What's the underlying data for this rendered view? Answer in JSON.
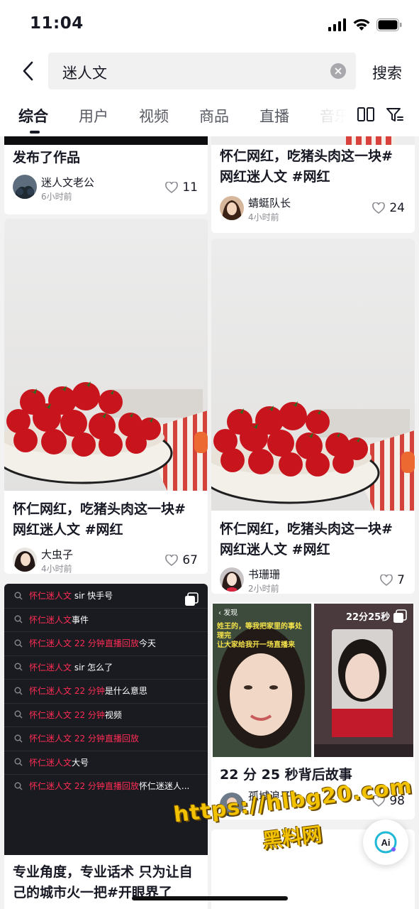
{
  "status": {
    "time": "11:04"
  },
  "search": {
    "query": "迷人文",
    "submit": "搜索"
  },
  "tabs": [
    {
      "label": "综合"
    },
    {
      "label": "用户"
    },
    {
      "label": "视频"
    },
    {
      "label": "商品"
    },
    {
      "label": "直播"
    },
    {
      "label": "音乐"
    }
  ],
  "cards": {
    "top_left": {
      "title": "发布了作品",
      "author": "迷人文老公",
      "time": "6小时前",
      "likes": "11"
    },
    "top_right": {
      "title_line1": "怀仁网红，吃猪头肉这一块#",
      "title_line2": "网红迷人文 #网红",
      "author": "蜻蜓队长",
      "time": "4小时前",
      "likes": "24"
    },
    "mid_left": {
      "title_line1": "怀仁网红，吃猪头肉这一块#",
      "title_line2": "网红迷人文 #网红",
      "author": "大虫子",
      "time": "4小时前",
      "likes": "67"
    },
    "mid_right": {
      "title_line1": "怀仁网红，吃猪头肉这一块#",
      "title_line2": "网红迷人文 #网红",
      "author": "书珊珊",
      "time": "2小时前",
      "likes": "7"
    },
    "suggest": {
      "items": [
        {
          "hl": "怀仁迷人文",
          "rest": " sir 快手号"
        },
        {
          "hl": "怀仁迷人文",
          "rest": "事件"
        },
        {
          "hl": "怀仁迷人文 22 分钟直播回放",
          "rest": "今天"
        },
        {
          "hl": "怀仁迷人文",
          "rest": " sir 怎么了"
        },
        {
          "hl": "怀仁迷人文 22 分钟",
          "rest": "是什么意思"
        },
        {
          "hl": "怀仁迷人文 22 分钟",
          "rest": "视频"
        },
        {
          "hl": "怀仁迷人文 22 分钟直播回放",
          "rest": ""
        },
        {
          "hl": "怀仁迷人文",
          "rest": "大号"
        },
        {
          "hl": "怀仁迷人文 22 分钟直播回放",
          "rest": "怀仁迷迷人..."
        }
      ],
      "title_line1": "专业角度，专业话术 只为让自",
      "title_line2": "己的城市火一把#开眼界了"
    },
    "video_card": {
      "back_label": "发现",
      "overlay_text_1": "姓王的，等我把家里的事处理完",
      "overlay_text_2": "让大家给我开一场直播来",
      "timer": "22分25秒",
      "title": "22 分 25 秒背后故事",
      "author": "孤城浪子",
      "likes": "98"
    }
  },
  "watermark": {
    "url": "https://hlbg20.com",
    "name": "黑料网"
  },
  "ai_button": {
    "label": "Ai"
  }
}
